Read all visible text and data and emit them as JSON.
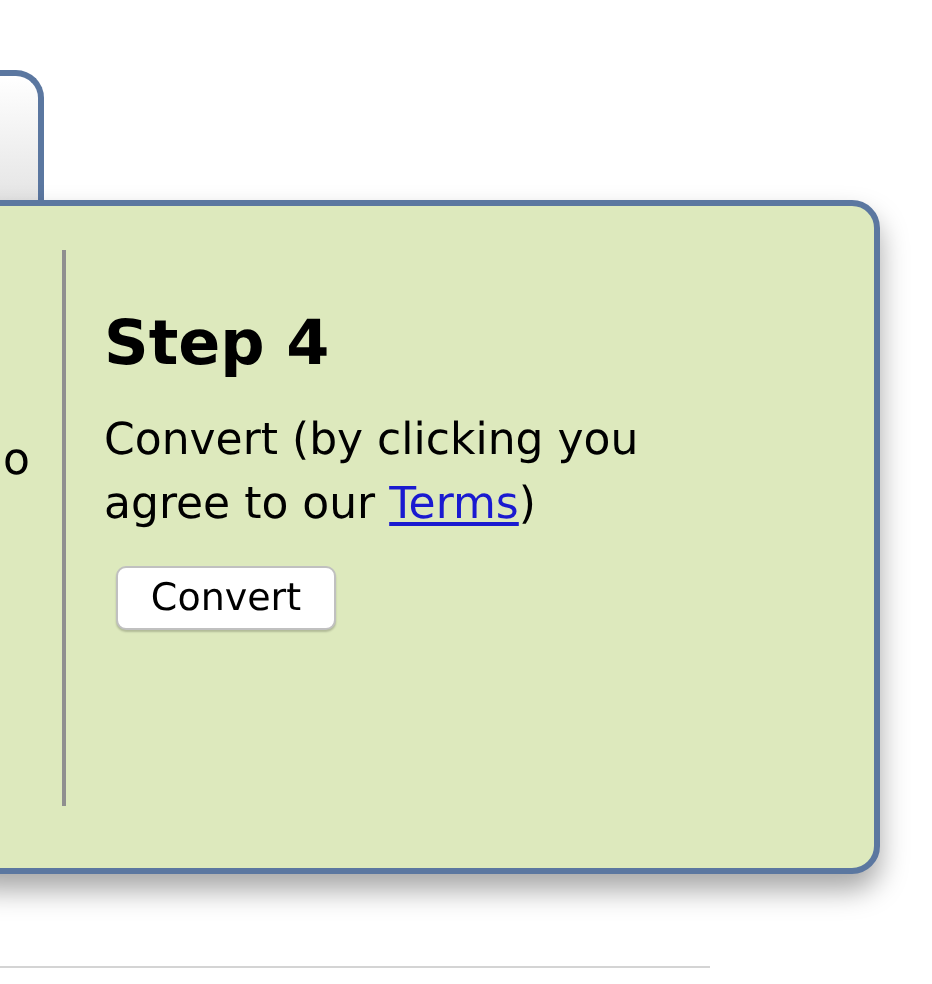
{
  "previous_step": {
    "text_fragment": "o"
  },
  "step": {
    "title": "Step 4",
    "description": "Convert (by clicking you agree to our ",
    "link": "Terms",
    "description_end": ")",
    "button": "Convert"
  }
}
